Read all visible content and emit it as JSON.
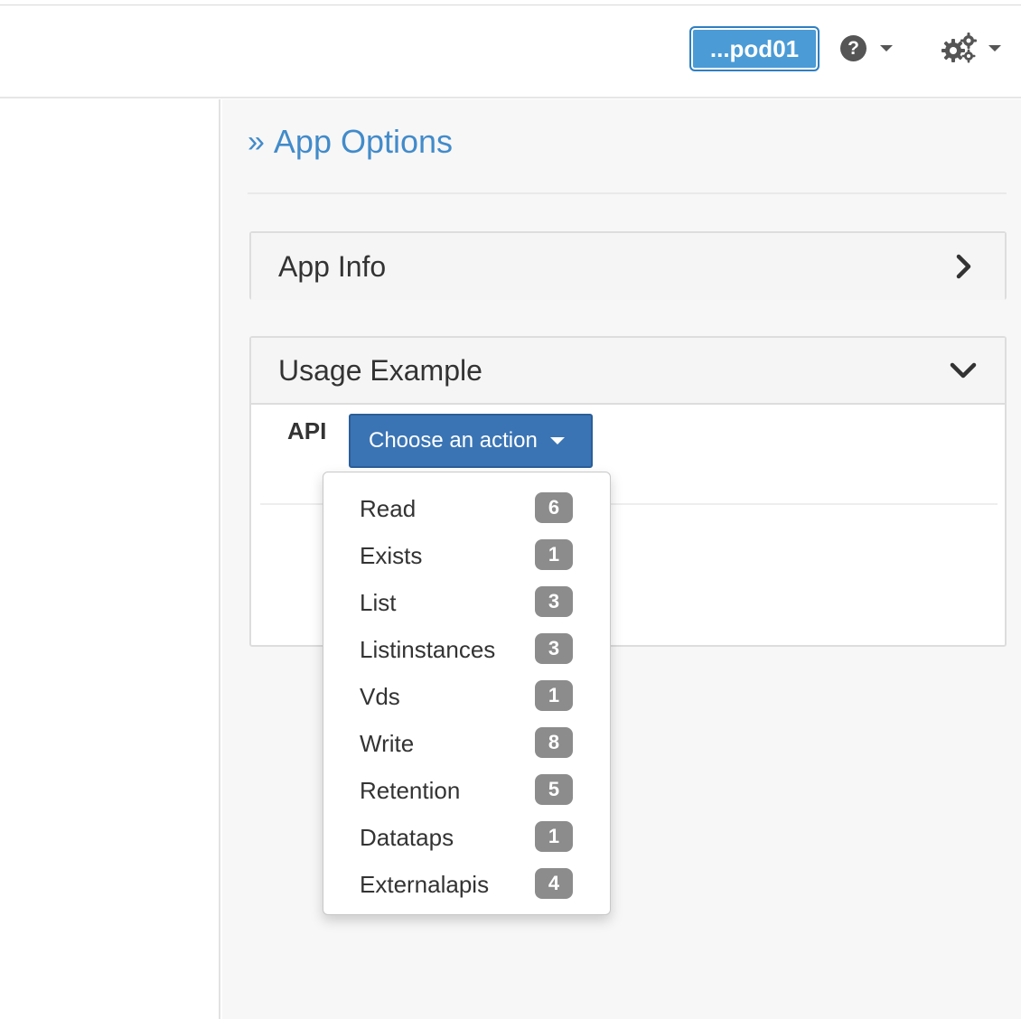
{
  "header": {
    "pod_label": "...pod01",
    "help_icon": "question-circle-icon",
    "settings_icon": "gears-icon"
  },
  "page": {
    "title_icon": "double-angle-right-icon",
    "title": "App Options"
  },
  "panels": {
    "app_info": {
      "title": "App Info",
      "state_icon": "chevron-right-icon"
    },
    "usage_example": {
      "title": "Usage Example",
      "state_icon": "chevron-down-icon"
    }
  },
  "usage": {
    "api_label": "API",
    "action_button_label": "Choose an action"
  },
  "dropdown": {
    "items": [
      {
        "label": "Read",
        "count": "6"
      },
      {
        "label": "Exists",
        "count": "1"
      },
      {
        "label": "List",
        "count": "3"
      },
      {
        "label": "Listinstances",
        "count": "3"
      },
      {
        "label": "Vds",
        "count": "1"
      },
      {
        "label": "Write",
        "count": "8"
      },
      {
        "label": "Retention",
        "count": "5"
      },
      {
        "label": "Datataps",
        "count": "1"
      },
      {
        "label": "Externalapis",
        "count": "4"
      }
    ]
  },
  "colors": {
    "link_blue": "#428bca",
    "pod_button": "#4a9bd6",
    "action_button": "#3a74b4",
    "badge_gray": "#8c8c8c"
  }
}
